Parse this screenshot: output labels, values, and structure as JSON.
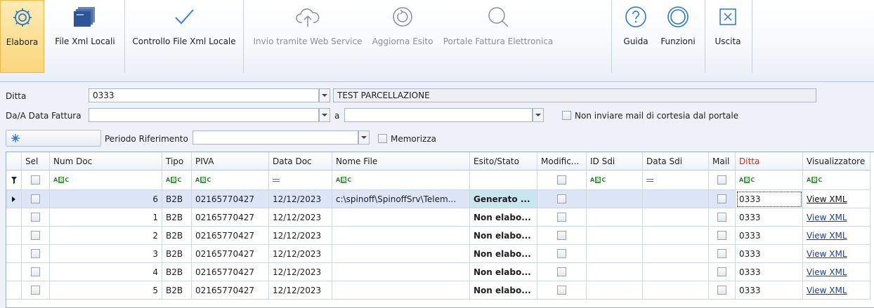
{
  "ribbon": {
    "buttons": [
      {
        "label": "Elabora"
      },
      {
        "label": "File Xml Locali"
      },
      {
        "label": "Controllo File Xml Locale"
      },
      {
        "label": "Invio tramite Web Service"
      },
      {
        "label": "Aggiorna Esito"
      },
      {
        "label": "Portale Fattura Elettronica"
      },
      {
        "label": "Guida"
      },
      {
        "label": "Funzioni"
      },
      {
        "label": "Uscita"
      }
    ]
  },
  "filters": {
    "ditta_label": "Ditta",
    "ditta_value": "0333",
    "ditta_name": "TEST PARCELLAZIONE",
    "data_fattura_label": "Da/A Data Fattura",
    "data_da": "",
    "a_label": "a",
    "data_a": "",
    "no_mail_label": "Non inviare mail di cortesia dal portale",
    "periodo_label": "Periodo Riferimento",
    "periodo_value": "",
    "memorizza_label": "Memorizza"
  },
  "grid": {
    "columns": [
      "Sel",
      "Num Doc",
      "Tipo",
      "PIVA",
      "Data Doc",
      "Nome File",
      "Esito/Stato",
      "Modific...",
      "ID Sdi",
      "Data Sdi",
      "Mail",
      "Ditta",
      "Visualizzatore"
    ],
    "rows": [
      {
        "num": "6",
        "tipo": "B2B",
        "piva": "02165770427",
        "data": "12/12/2023",
        "file": "c:\\spinoff\\SpinoffSrv\\Telem...",
        "esito": "Generato ...",
        "ditta": "0333",
        "vis": "View XML"
      },
      {
        "num": "1",
        "tipo": "B2B",
        "piva": "02165770427",
        "data": "12/12/2023",
        "file": "",
        "esito": "Non elabo...",
        "ditta": "0333",
        "vis": "View XML"
      },
      {
        "num": "2",
        "tipo": "B2B",
        "piva": "02165770427",
        "data": "12/12/2023",
        "file": "",
        "esito": "Non elabo...",
        "ditta": "0333",
        "vis": "View XML"
      },
      {
        "num": "3",
        "tipo": "B2B",
        "piva": "02165770427",
        "data": "12/12/2023",
        "file": "",
        "esito": "Non elabo...",
        "ditta": "0333",
        "vis": "View XML"
      },
      {
        "num": "4",
        "tipo": "B2B",
        "piva": "02165770427",
        "data": "12/12/2023",
        "file": "",
        "esito": "Non elabo...",
        "ditta": "0333",
        "vis": "View XML"
      },
      {
        "num": "5",
        "tipo": "B2B",
        "piva": "02165770427",
        "data": "12/12/2023",
        "file": "",
        "esito": "Non elabo...",
        "ditta": "0333",
        "vis": "View XML"
      }
    ]
  }
}
